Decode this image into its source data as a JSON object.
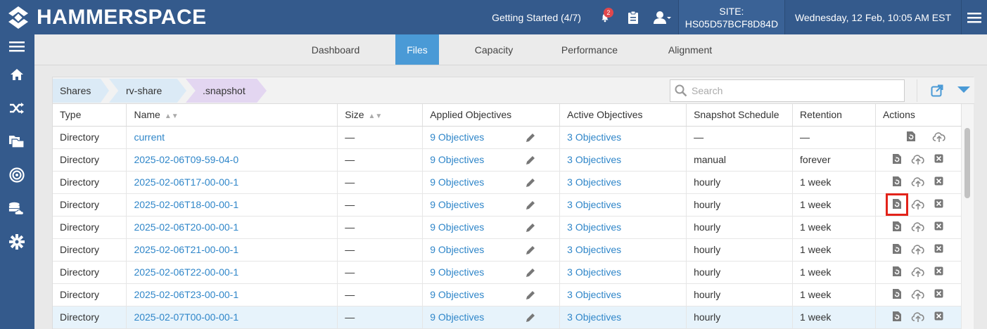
{
  "header": {
    "brand": "HAMMERSPACE",
    "getting_started": "Getting Started (4/7)",
    "notification_count": "2",
    "site_label": "SITE:",
    "site_id": "HS05D57BCF8D84D",
    "datetime": "Wednesday, 12 Feb, 10:05 AM EST",
    "accent_color": "#345a8c"
  },
  "sidebar": {
    "icons": [
      "menu-icon",
      "home-icon",
      "shuffle-icon",
      "shares-icon",
      "target-icon",
      "storage-cloud-icon",
      "gear-icon"
    ]
  },
  "tabs": [
    {
      "label": "Dashboard",
      "active": false
    },
    {
      "label": "Files",
      "active": true
    },
    {
      "label": "Capacity",
      "active": false
    },
    {
      "label": "Performance",
      "active": false
    },
    {
      "label": "Alignment",
      "active": false
    }
  ],
  "breadcrumb": [
    "Shares",
    "rv-share",
    ".snapshot"
  ],
  "search": {
    "placeholder": "Search"
  },
  "table": {
    "headers": [
      "Type",
      "Name",
      "Size",
      "Applied Objectives",
      "Active Objectives",
      "Snapshot Schedule",
      "Retention",
      "Actions"
    ],
    "rows": [
      {
        "type": "Directory",
        "name": "current",
        "size": "—",
        "applied": "9 Objectives",
        "active": "3 Objectives",
        "schedule": "—",
        "retention": "—"
      },
      {
        "type": "Directory",
        "name": "2025-02-06T09-59-04-0",
        "size": "—",
        "applied": "9 Objectives",
        "active": "3 Objectives",
        "schedule": "manual",
        "retention": "forever"
      },
      {
        "type": "Directory",
        "name": "2025-02-06T17-00-00-1",
        "size": "—",
        "applied": "9 Objectives",
        "active": "3 Objectives",
        "schedule": "hourly",
        "retention": "1 week"
      },
      {
        "type": "Directory",
        "name": "2025-02-06T18-00-00-1",
        "size": "—",
        "applied": "9 Objectives",
        "active": "3 Objectives",
        "schedule": "hourly",
        "retention": "1 week"
      },
      {
        "type": "Directory",
        "name": "2025-02-06T20-00-00-1",
        "size": "—",
        "applied": "9 Objectives",
        "active": "3 Objectives",
        "schedule": "hourly",
        "retention": "1 week"
      },
      {
        "type": "Directory",
        "name": "2025-02-06T21-00-00-1",
        "size": "—",
        "applied": "9 Objectives",
        "active": "3 Objectives",
        "schedule": "hourly",
        "retention": "1 week"
      },
      {
        "type": "Directory",
        "name": "2025-02-06T22-00-00-1",
        "size": "—",
        "applied": "9 Objectives",
        "active": "3 Objectives",
        "schedule": "hourly",
        "retention": "1 week"
      },
      {
        "type": "Directory",
        "name": "2025-02-06T23-00-00-1",
        "size": "—",
        "applied": "9 Objectives",
        "active": "3 Objectives",
        "schedule": "hourly",
        "retention": "1 week"
      },
      {
        "type": "Directory",
        "name": "2025-02-07T00-00-00-1",
        "size": "—",
        "applied": "9 Objectives",
        "active": "3 Objectives",
        "schedule": "hourly",
        "retention": "1 week"
      }
    ]
  }
}
